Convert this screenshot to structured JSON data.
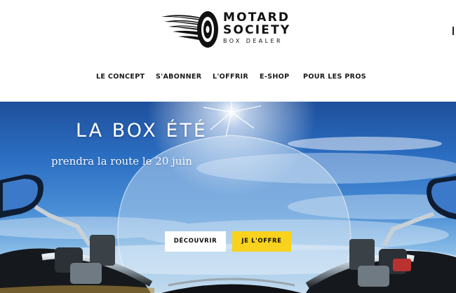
{
  "brand": {
    "title_line1": "MOTARD",
    "title_line2": "SOCIETY",
    "subtitle": "BOX DEALER",
    "logo_icon": "winged-wheel-icon"
  },
  "nav": {
    "items": [
      {
        "label": "LE CONCEPT"
      },
      {
        "label": "S'ABONNER"
      },
      {
        "label": "L'OFFRIR"
      },
      {
        "label": "E-SHOP"
      },
      {
        "label": "POUR LES PROS"
      }
    ]
  },
  "hero": {
    "title": "LA BOX ÉTÉ",
    "subtitle": "prendra la route le 20 juin",
    "discover_label": "DÉCOUVRIR",
    "gift_label": "JE L'OFFRE"
  },
  "colors": {
    "accent": "#f8d21c",
    "sky": "#2c6fc3",
    "text": "#111111"
  }
}
